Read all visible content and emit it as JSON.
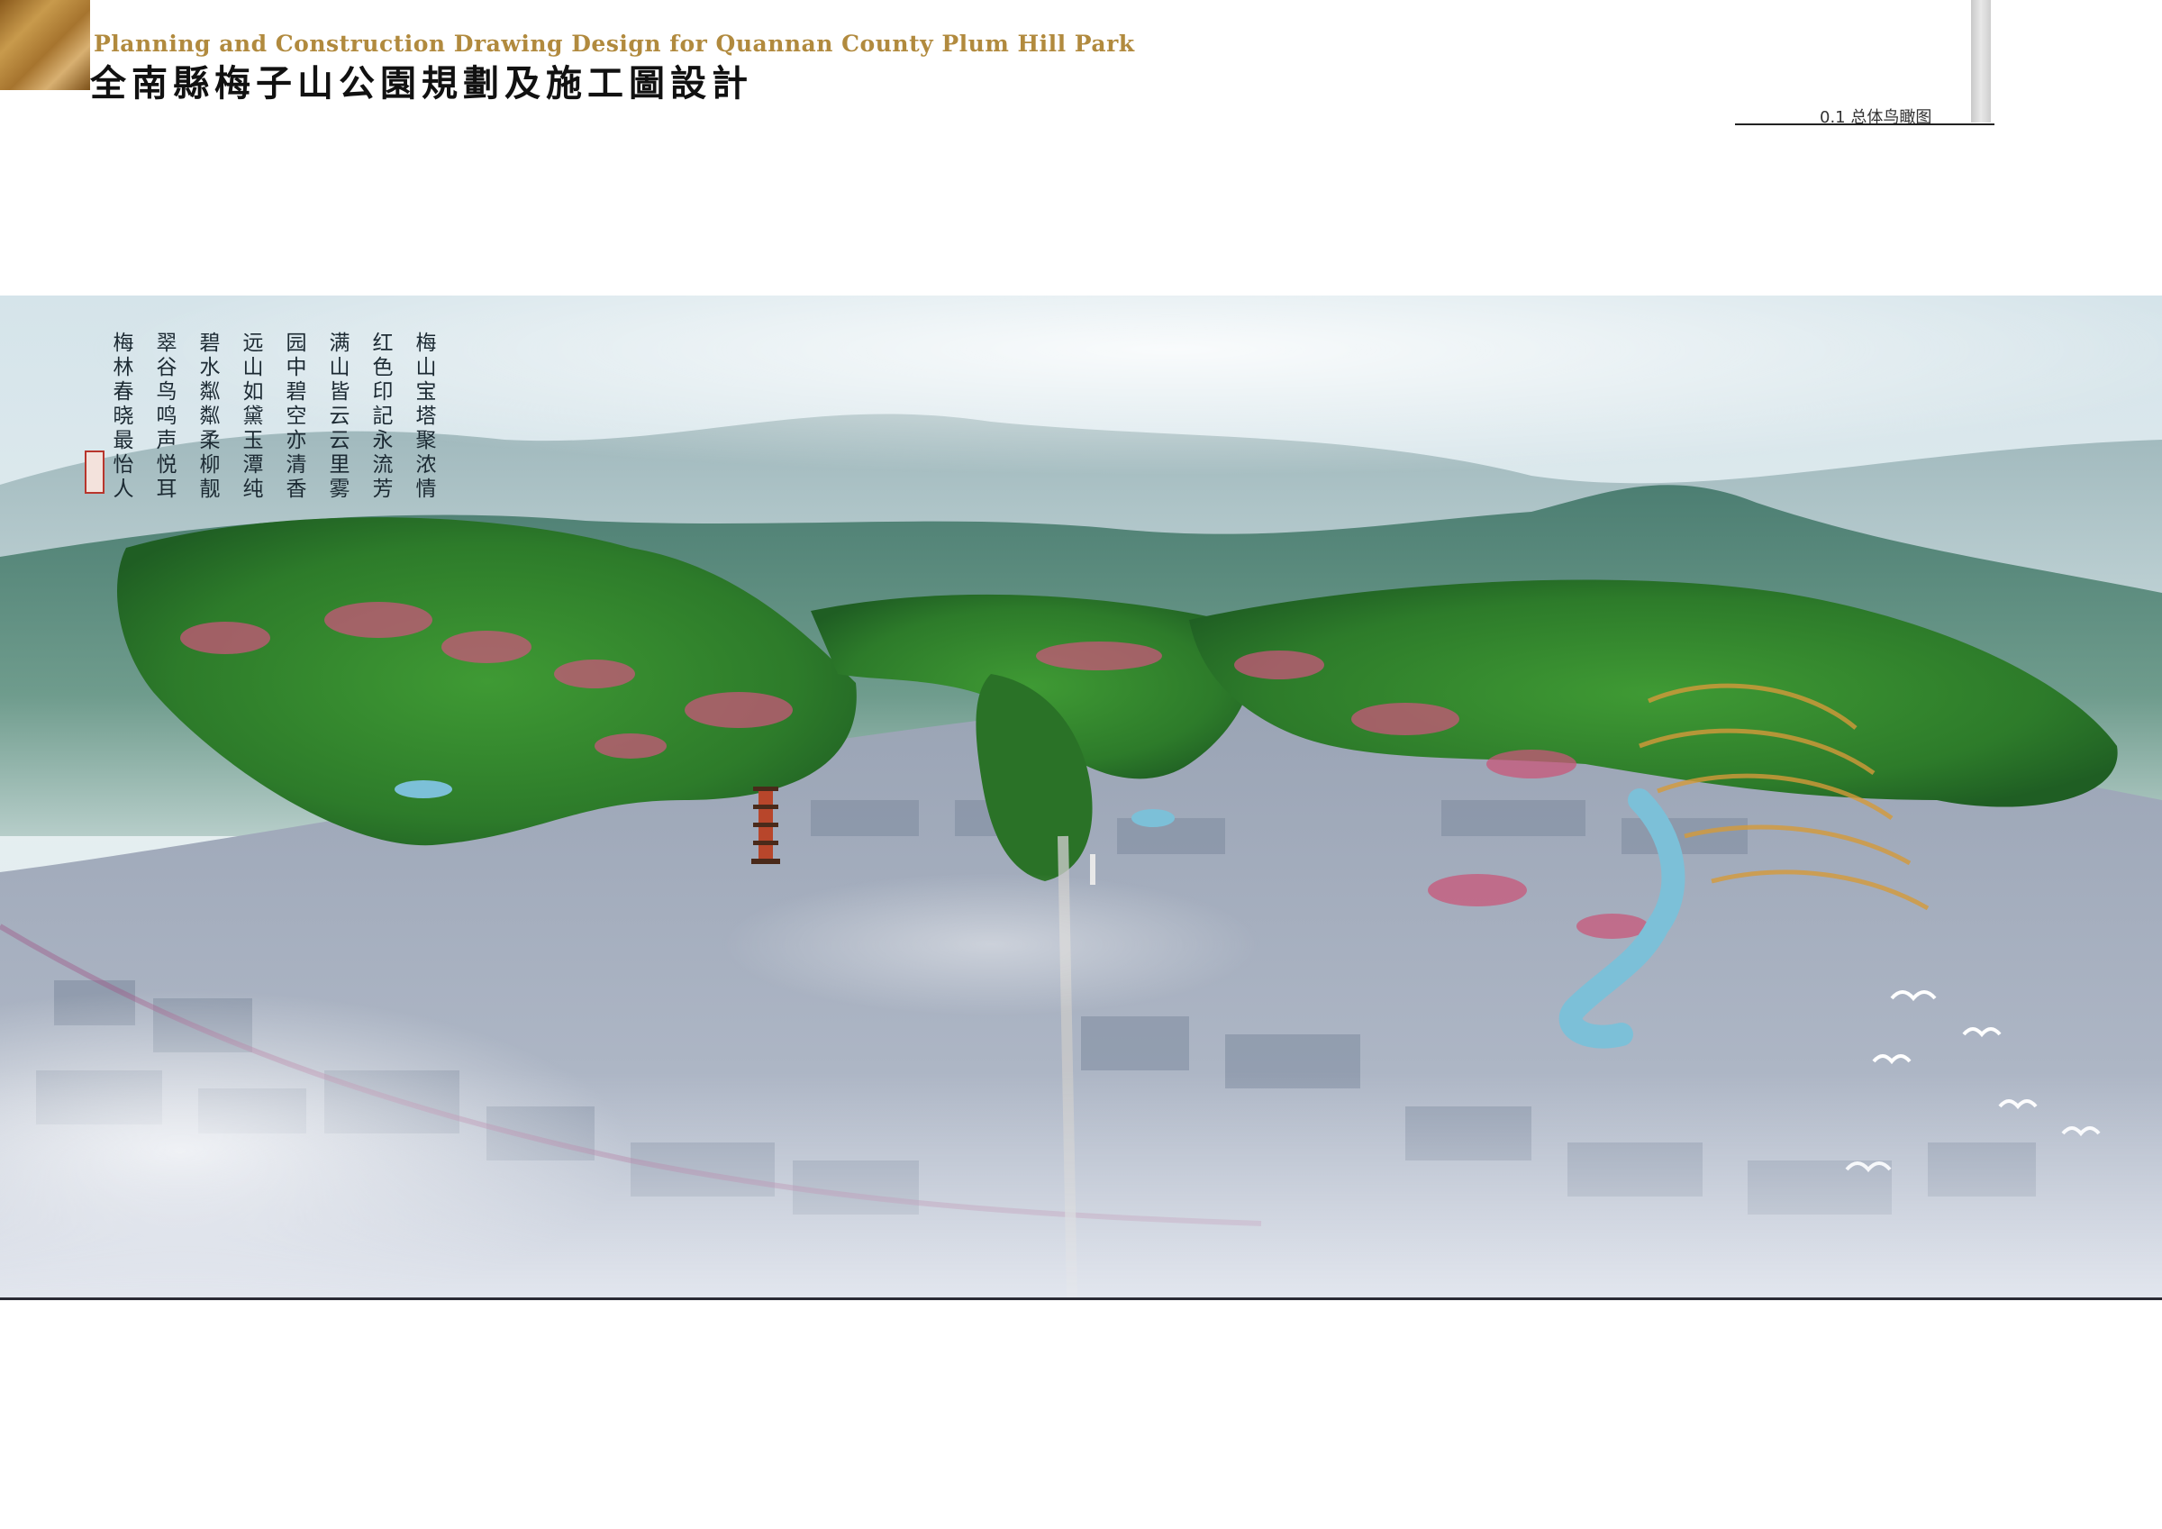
{
  "header": {
    "title_en": "Planning and Construction Drawing Design for Quannan County Plum Hill Park",
    "title_cn": "全南縣梅子山公園規劃及施工圖設計",
    "sheet_label": "0.1 总体鸟瞰图"
  },
  "poem": {
    "lines": [
      "梅山宝塔聚浓情",
      "红色印記永流芳",
      "满山皆云云里雾",
      "园中碧空亦清香",
      "远山如黛玉潭纯",
      "碧水粼粼柔柳靓",
      "翠谷鸟鸣声悦耳",
      "梅林春晓最怡人"
    ]
  },
  "colors": {
    "title_gold": "#b18a3e",
    "sky": "#dde9ec",
    "forest": "#2f7d2c",
    "blossom": "#c8577a",
    "water": "#7cc0d8",
    "city": "#8e99ac"
  }
}
